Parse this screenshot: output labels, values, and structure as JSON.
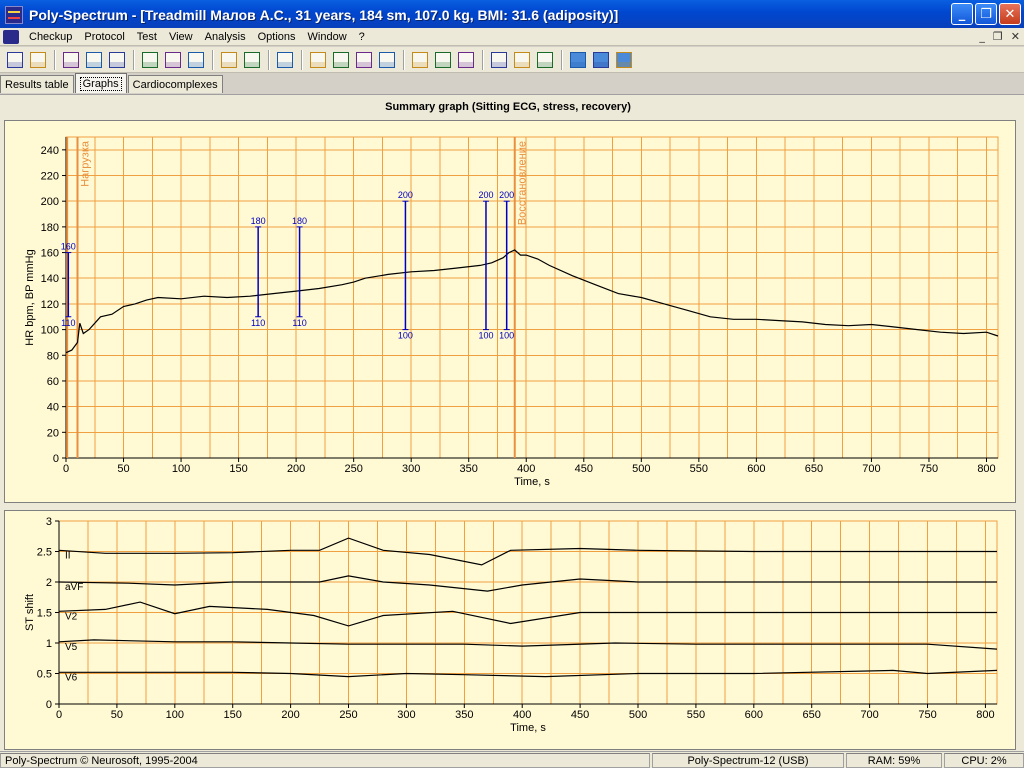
{
  "window": {
    "title": "Poly-Spectrum - [Treadmill Малов А.С., 31 years, 184 sm, 107.0 kg, BMI: 31.6 (adiposity)]",
    "buttons": [
      "_",
      "❐",
      "✕"
    ]
  },
  "menu": {
    "items": [
      "Checkup",
      "Protocol",
      "Test",
      "View",
      "Analysis",
      "Options",
      "Window",
      "?"
    ],
    "mdi_buttons": [
      "_",
      "❐",
      "✕"
    ]
  },
  "toolbar": {
    "icons": [
      "patient-list-icon",
      "checkup-icon",
      "open-icon",
      "save-icon",
      "export-icon",
      "print-preview-icon",
      "print-icon",
      "report-icon",
      "ecg-icon",
      "ecg-alt-icon",
      "zoom-icon",
      "line-graph-icon",
      "area-graph-icon",
      "bar-graph-icon",
      "scatter-icon",
      "markers-icon",
      "markers-alt-icon",
      "markers-3-icon",
      "kbt-icon",
      "treadmill-icon",
      "trend-icon",
      "window-cascade-icon",
      "window-tile-h-icon",
      "window-tile-v-icon"
    ]
  },
  "tabs": [
    "Results table",
    "Graphs",
    "Cardiocomplexes"
  ],
  "active_tab": "Graphs",
  "summary_title": "Summary graph (Sitting ECG, stress, recovery)",
  "status": {
    "copyright": "Poly-Spectrum © Neurosoft, 1995-2004",
    "device": "Poly-Spectrum-12 (USB)",
    "ram": "RAM: 59%",
    "cpu": "CPU: 2%"
  },
  "colors": {
    "panel_bg": "#fff9d4",
    "grid": "#f0a040",
    "bp_marker": "#0000c0",
    "trace": "#000000"
  },
  "chart_data": [
    {
      "type": "line",
      "title": "Summary graph (Sitting ECG, stress, recovery)",
      "xlabel": "Time, s",
      "ylabel": "HR bpm, BP mmHg",
      "xlim": [
        0,
        810
      ],
      "ylim": [
        0,
        250
      ],
      "xticks": [
        0,
        50,
        100,
        150,
        200,
        250,
        300,
        350,
        400,
        450,
        500,
        550,
        600,
        650,
        700,
        750,
        800
      ],
      "yticks": [
        0,
        20,
        40,
        60,
        80,
        100,
        120,
        140,
        160,
        180,
        200,
        220,
        240
      ],
      "grid": true,
      "phase_markers": [
        {
          "x": 10,
          "label": "Нагрузка"
        },
        {
          "x": 390,
          "label": "Восстановление"
        }
      ],
      "series": [
        {
          "x": [
            0,
            5,
            10,
            12,
            15,
            20,
            25,
            30,
            40,
            50,
            60,
            70,
            80,
            100,
            120,
            140,
            160,
            180,
            200,
            220,
            240,
            250,
            260,
            280,
            300,
            320,
            340,
            360,
            370,
            380,
            385,
            390,
            395,
            400,
            410,
            420,
            440,
            460,
            480,
            500,
            520,
            540,
            560,
            580,
            600,
            620,
            640,
            660,
            680,
            700,
            720,
            740,
            760,
            780,
            800,
            810
          ],
          "y": [
            82,
            84,
            90,
            105,
            97,
            100,
            105,
            110,
            112,
            118,
            120,
            123,
            125,
            124,
            126,
            125,
            126,
            128,
            130,
            132,
            135,
            137,
            140,
            143,
            145,
            146,
            148,
            150,
            152,
            156,
            160,
            162,
            158,
            158,
            155,
            150,
            142,
            135,
            128,
            125,
            120,
            115,
            110,
            108,
            108,
            107,
            106,
            104,
            103,
            104,
            102,
            100,
            98,
            97,
            98,
            95
          ]
        }
      ],
      "bp_measurements": [
        {
          "x": 2,
          "sys": 160,
          "dia": 110
        },
        {
          "x": 167,
          "sys": 180,
          "dia": 110
        },
        {
          "x": 203,
          "sys": 180,
          "dia": 110
        },
        {
          "x": 295,
          "sys": 200,
          "dia": 100
        },
        {
          "x": 365,
          "sys": 200,
          "dia": 100
        },
        {
          "x": 383,
          "sys": 200,
          "dia": 100
        }
      ]
    },
    {
      "type": "line",
      "xlabel": "Time, s",
      "ylabel": "ST shift",
      "xlim": [
        0,
        810
      ],
      "ylim": [
        0,
        3
      ],
      "xticks": [
        0,
        50,
        100,
        150,
        200,
        250,
        300,
        350,
        400,
        450,
        500,
        550,
        600,
        650,
        700,
        750,
        800
      ],
      "yticks": [
        0,
        0.5,
        1,
        1.5,
        2,
        2.5,
        3
      ],
      "grid": true,
      "series": [
        {
          "name": "II",
          "x": [
            0,
            40,
            100,
            150,
            200,
            225,
            250,
            280,
            320,
            365,
            390,
            450,
            500,
            600,
            700,
            810
          ],
          "y": [
            2.52,
            2.47,
            2.47,
            2.48,
            2.52,
            2.52,
            2.72,
            2.52,
            2.45,
            2.28,
            2.52,
            2.55,
            2.52,
            2.5,
            2.5,
            2.5
          ]
        },
        {
          "name": "aVF",
          "x": [
            0,
            60,
            100,
            150,
            225,
            250,
            280,
            320,
            370,
            400,
            450,
            500,
            600,
            700,
            810
          ],
          "y": [
            2.0,
            1.98,
            1.95,
            2.0,
            2.0,
            2.1,
            2.0,
            1.95,
            1.85,
            1.95,
            2.05,
            2.0,
            2.0,
            2.0,
            2.0
          ]
        },
        {
          "name": "V2",
          "x": [
            0,
            40,
            70,
            100,
            130,
            180,
            220,
            250,
            280,
            340,
            390,
            450,
            500,
            600,
            700,
            810
          ],
          "y": [
            1.52,
            1.55,
            1.67,
            1.48,
            1.6,
            1.55,
            1.45,
            1.28,
            1.45,
            1.52,
            1.32,
            1.5,
            1.5,
            1.5,
            1.5,
            1.5
          ]
        },
        {
          "name": "V5",
          "x": [
            0,
            30,
            100,
            150,
            200,
            250,
            300,
            350,
            400,
            480,
            550,
            650,
            750,
            810
          ],
          "y": [
            1.02,
            1.05,
            1.02,
            1.02,
            1.0,
            0.98,
            0.98,
            0.98,
            0.95,
            1.0,
            0.98,
            0.98,
            0.98,
            0.9
          ]
        },
        {
          "name": "V6",
          "x": [
            0,
            50,
            150,
            200,
            250,
            300,
            350,
            420,
            500,
            600,
            720,
            750,
            810
          ],
          "y": [
            0.52,
            0.52,
            0.52,
            0.5,
            0.45,
            0.5,
            0.48,
            0.45,
            0.5,
            0.5,
            0.55,
            0.5,
            0.55
          ]
        }
      ]
    }
  ]
}
